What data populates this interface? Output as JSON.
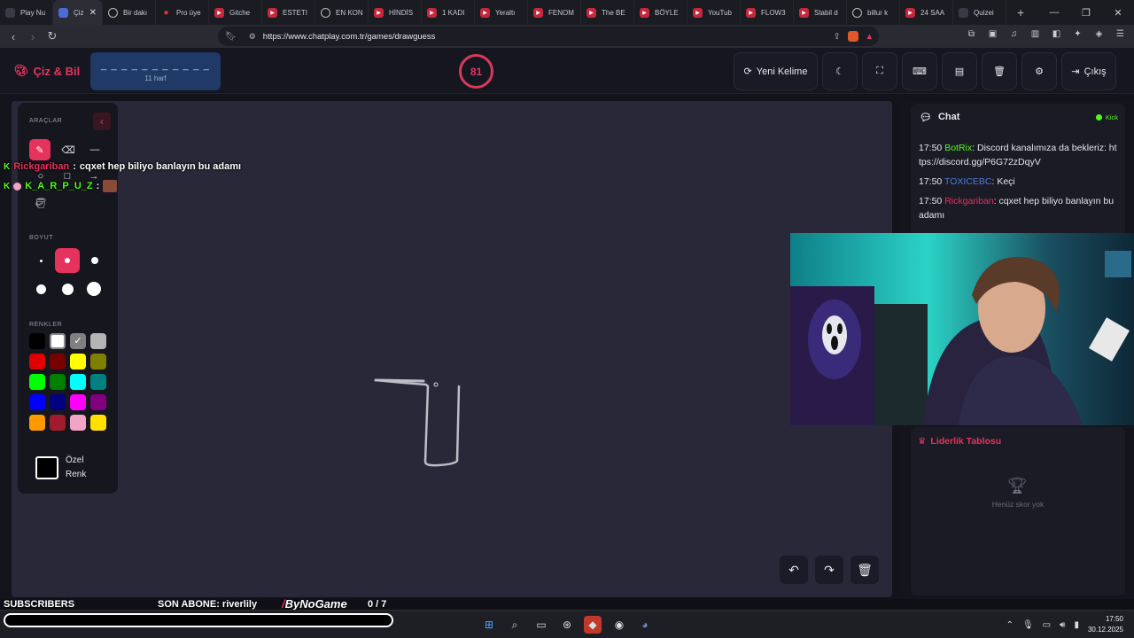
{
  "browser": {
    "tabs": [
      {
        "title": "Play Nu",
        "icon": "play-icon"
      },
      {
        "title": "Çiz",
        "icon": "chatplay-icon",
        "active": true
      },
      {
        "title": "Bir dakı",
        "icon": "globe-icon"
      },
      {
        "title": "Pro üye",
        "icon": "map-pin-icon"
      },
      {
        "title": "Gitche",
        "icon": "youtube-icon"
      },
      {
        "title": "ESTETI",
        "icon": "youtube-icon"
      },
      {
        "title": "EN KON",
        "icon": "globe-icon"
      },
      {
        "title": "HİNDİS",
        "icon": "youtube-icon"
      },
      {
        "title": "1 KADI",
        "icon": "youtube-icon"
      },
      {
        "title": "Yeraltı",
        "icon": "youtube-icon"
      },
      {
        "title": "FENOM",
        "icon": "youtube-icon"
      },
      {
        "title": "The BE",
        "icon": "youtube-icon"
      },
      {
        "title": "BÖYLE",
        "icon": "youtube-icon"
      },
      {
        "title": "YouTub",
        "icon": "youtube-icon"
      },
      {
        "title": "FLOW3",
        "icon": "youtube-icon"
      },
      {
        "title": "Stabil d",
        "icon": "youtube-icon"
      },
      {
        "title": "billur k",
        "icon": "globe-icon"
      },
      {
        "title": "24 SAA",
        "icon": "youtube-icon"
      },
      {
        "title": "Quizei",
        "icon": "quiz-icon"
      }
    ],
    "url": "https://www.chatplay.com.tr/games/drawguess"
  },
  "header": {
    "logo": "Çiz & Bil",
    "word_dashes": "_ _ _ _ _ _ _ _ _ _ _",
    "word_hint": "11 harf",
    "timer": "81",
    "new_word_label": "Yeni Kelime",
    "exit_label": "Çıkış"
  },
  "tools": {
    "tools_title": "ARAÇLAR",
    "size_title": "BOYUT",
    "colors_title": "RENKLER",
    "custom_color_line1": "Özel",
    "custom_color_line2": "Renk",
    "colors": [
      "#000000",
      "#ffffff",
      "#808080",
      "#b4b4b4",
      "#e00000",
      "#7a0000",
      "#ffff00",
      "#808000",
      "#00ff00",
      "#008000",
      "#00ffff",
      "#008080",
      "#0000ff",
      "#000080",
      "#ff00ff",
      "#800080",
      "#ff9900",
      "#a01c2c",
      "#f2a4c6",
      "#ffe000"
    ]
  },
  "overlay_chat": [
    {
      "name": "Rickgariban",
      "sep": ":",
      "text": "cqxet hep biliyo banlayın bu adamı",
      "color": "#e5335d"
    },
    {
      "name": "K_A_R_P_U_Z",
      "sep": ":",
      "text": "",
      "color": "#53fc18"
    }
  ],
  "chat": {
    "title": "Chat",
    "platform": "Kick",
    "messages": [
      {
        "time": "17:50",
        "user": "BotRix",
        "user_color": "#53fc18",
        "text": "Discord kanalımıza da bekleriz: https://discord.gg/P6G72zDqyV"
      },
      {
        "time": "17:50",
        "user": "TOXICEBC",
        "user_color": "#4a7bdc",
        "text": "Keçi"
      },
      {
        "time": "17:50",
        "user": "Rickgariban",
        "user_color": "#e5335d",
        "text": "cqxet hep biliyo banlayın bu adamı"
      }
    ]
  },
  "leaderboard": {
    "title": "Liderlik Tablosu",
    "empty_text": "Henüz skor yok"
  },
  "stream_overlay": {
    "subscribers_label": "SUBSCRIBERS",
    "last_sub": "SON ABONE: riverlily",
    "brand": "ByNoGame",
    "count": "0 / 7"
  },
  "taskbar": {
    "time": "17:50",
    "date": "30.12.2025"
  }
}
